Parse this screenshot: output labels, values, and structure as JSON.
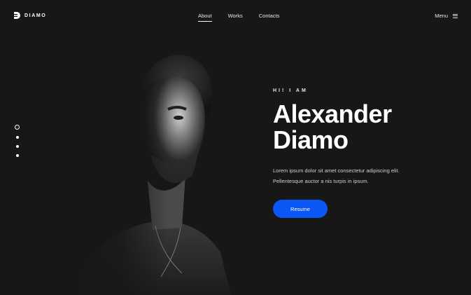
{
  "brand": {
    "name": "DIAMO"
  },
  "nav": {
    "items": [
      {
        "label": "About",
        "active": true
      },
      {
        "label": "Works",
        "active": false
      },
      {
        "label": "Contacts",
        "active": false
      }
    ]
  },
  "menu": {
    "label": "Menu",
    "icon": "hamburger-icon"
  },
  "pagination": {
    "count": 4,
    "active_index": 0
  },
  "hero": {
    "kicker": "HI! I AM",
    "name_line1": "Alexander",
    "name_line2": "Diamo",
    "desc_line1": "Lorem ipsum dolor sit amet consectetur adipiscing elit.",
    "desc_line2": "Pellentesque auctor a nis turpis in ipsum.",
    "button_label": "Resume"
  },
  "colors": {
    "background": "#171717",
    "accent": "#0a57f5",
    "text": "#ffffff"
  }
}
